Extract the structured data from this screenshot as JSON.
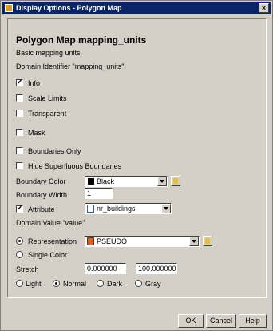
{
  "window": {
    "title": "Display Options - Polygon Map",
    "close_label": "×"
  },
  "header": {
    "map_title": "Polygon Map  mapping_units",
    "subtitle": "Basic mapping units",
    "domain_identifier": "Domain Identifier \"mapping_units\""
  },
  "options": {
    "info": {
      "label": "Info",
      "checked": true
    },
    "scale_limits": {
      "label": "Scale Limits",
      "checked": false
    },
    "transparent": {
      "label": "Transparent",
      "checked": false
    },
    "mask": {
      "label": "Mask",
      "checked": false
    },
    "boundaries_only": {
      "label": "Boundaries Only",
      "checked": false
    },
    "hide_superfluous": {
      "label": "Hide Superfluous Boundaries",
      "checked": false
    }
  },
  "boundary": {
    "color_label": "Boundary Color",
    "color_value": "Black",
    "width_label": "Boundary Width",
    "width_value": "1"
  },
  "attribute": {
    "label": "Attribute",
    "checked": true,
    "value": "nr_buildings"
  },
  "domain_value": "Domain Value \"value\"",
  "representation": {
    "label": "Representation",
    "selected": true,
    "value": "PSEUDO"
  },
  "single_color": {
    "label": "Single Color",
    "selected": false
  },
  "stretch": {
    "label": "Stretch",
    "min": "0.000000",
    "max": "100.000000"
  },
  "shading": {
    "light": "Light",
    "normal": "Normal",
    "dark": "Dark",
    "gray": "Gray",
    "selected": "Normal"
  },
  "buttons": {
    "ok": "OK",
    "cancel": "Cancel",
    "help": "Help"
  },
  "colors": {
    "titlebar": "#0a246a",
    "dialog": "#d4d0c8"
  }
}
